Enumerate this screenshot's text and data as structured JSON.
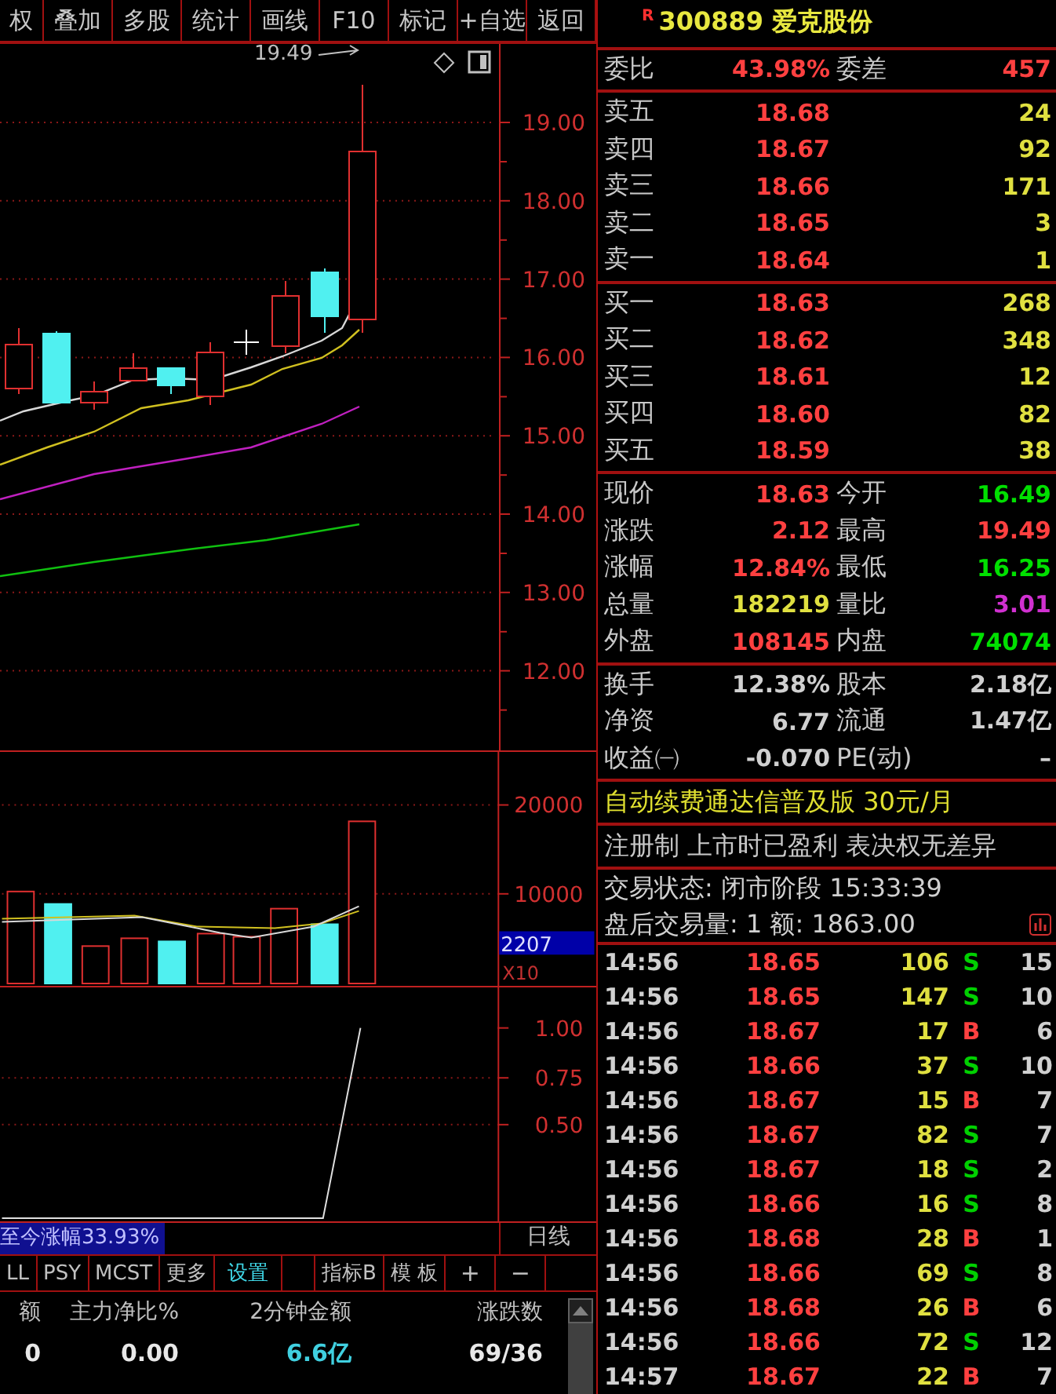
{
  "toolbar": [
    "权",
    "叠加",
    "多股",
    "统计",
    "画线",
    "F10",
    "标记",
    "+自选",
    "返回"
  ],
  "price_chart": {
    "high_label": "19.49",
    "axis_labels": [
      "19.00",
      "18.00",
      "17.00",
      "16.00",
      "15.00",
      "14.00",
      "13.00",
      "12.00"
    ]
  },
  "volume_chart": {
    "axis_labels": [
      "20000",
      "10000"
    ],
    "current_volume": "2207",
    "unit": "X10"
  },
  "indicator_chart": {
    "axis_labels": [
      "1.00",
      "0.75",
      "0.50"
    ]
  },
  "range_gain": "至今涨幅33.93%",
  "period": "日线",
  "indicator_tabs": [
    {
      "label": "LL",
      "selected": false
    },
    {
      "label": "PSY",
      "selected": false
    },
    {
      "label": "MCST",
      "selected": false
    },
    {
      "label": "更多",
      "selected": false
    },
    {
      "label": "设置",
      "selected": true
    },
    {
      "label": "指标B",
      "selected": false
    },
    {
      "label": "模 板",
      "selected": false
    }
  ],
  "zoom_buttons": [
    "+",
    "−"
  ],
  "sector_table": {
    "columns": [
      "额",
      "主力净比%",
      "2分钟金额",
      "涨跌数"
    ],
    "rows": [
      [
        "0",
        "0.00",
        "6.6亿",
        "69/36"
      ]
    ]
  },
  "stock": {
    "flag": "R",
    "title": "300889 爱克股份"
  },
  "order_ratio": [
    {
      "label": "委比",
      "value": "43.98%"
    },
    {
      "label": "委差",
      "value": "457"
    }
  ],
  "asks": [
    {
      "label": "卖五",
      "price": "18.68",
      "volume": "24"
    },
    {
      "label": "卖四",
      "price": "18.67",
      "volume": "92"
    },
    {
      "label": "卖三",
      "price": "18.66",
      "volume": "171"
    },
    {
      "label": "卖二",
      "price": "18.65",
      "volume": "3"
    },
    {
      "label": "卖一",
      "price": "18.64",
      "volume": "1"
    }
  ],
  "bids": [
    {
      "label": "买一",
      "price": "18.63",
      "volume": "268"
    },
    {
      "label": "买二",
      "price": "18.62",
      "volume": "348"
    },
    {
      "label": "买三",
      "price": "18.61",
      "volume": "12"
    },
    {
      "label": "买四",
      "price": "18.60",
      "volume": "82"
    },
    {
      "label": "买五",
      "price": "18.59",
      "volume": "38"
    }
  ],
  "quote": [
    {
      "label": "现价",
      "value": "18.63",
      "color": "#ff4040"
    },
    {
      "label": "今开",
      "value": "16.49",
      "color": "#00e000"
    },
    {
      "label": "涨跌",
      "value": "2.12",
      "color": "#ff4040"
    },
    {
      "label": "最高",
      "value": "19.49",
      "color": "#ff4040"
    },
    {
      "label": "涨幅",
      "value": "12.84%",
      "color": "#ff4040"
    },
    {
      "label": "最低",
      "value": "16.25",
      "color": "#00e000"
    },
    {
      "label": "总量",
      "value": "182219",
      "color": "#e0e040"
    },
    {
      "label": "量比",
      "value": "3.01",
      "color": "#d030d0"
    },
    {
      "label": "外盘",
      "value": "108145",
      "color": "#ff4040"
    },
    {
      "label": "内盘",
      "value": "74074",
      "color": "#00e000"
    }
  ],
  "fundamentals": [
    {
      "label": "换手",
      "value": "12.38%"
    },
    {
      "label": "股本",
      "value": "2.18亿"
    },
    {
      "label": "净资",
      "value": "6.77"
    },
    {
      "label": "流通",
      "value": "1.47亿"
    },
    {
      "label": "收益㈠",
      "value": "-0.070"
    },
    {
      "label": "PE(动)",
      "value": "–"
    }
  ],
  "promo": "自动续费通达信普及版  30元/月",
  "tags": "注册制 上市时已盈利 表决权无差异",
  "status": "交易状态: 闭市阶段 15:33:39",
  "after_hours": "盘后交易量: 1  额: 1863.00",
  "ticks": [
    {
      "time": "14:56",
      "price": "18.65",
      "volume": "106",
      "side": "S",
      "color": "#00d000",
      "count": "15"
    },
    {
      "time": "14:56",
      "price": "18.65",
      "volume": "147",
      "side": "S",
      "color": "#00d000",
      "count": "10"
    },
    {
      "time": "14:56",
      "price": "18.67",
      "volume": "17",
      "side": "B",
      "color": "#ff4040",
      "count": "6"
    },
    {
      "time": "14:56",
      "price": "18.66",
      "volume": "37",
      "side": "S",
      "color": "#00d000",
      "count": "10"
    },
    {
      "time": "14:56",
      "price": "18.67",
      "volume": "15",
      "side": "B",
      "color": "#ff4040",
      "count": "7"
    },
    {
      "time": "14:56",
      "price": "18.67",
      "volume": "82",
      "side": "S",
      "color": "#00d000",
      "count": "7"
    },
    {
      "time": "14:56",
      "price": "18.67",
      "volume": "18",
      "side": "S",
      "color": "#00d000",
      "count": "2"
    },
    {
      "time": "14:56",
      "price": "18.66",
      "volume": "16",
      "side": "S",
      "color": "#00d000",
      "count": "8"
    },
    {
      "time": "14:56",
      "price": "18.68",
      "volume": "28",
      "side": "B",
      "color": "#ff4040",
      "count": "1"
    },
    {
      "time": "14:56",
      "price": "18.66",
      "volume": "69",
      "side": "S",
      "color": "#00d000",
      "count": "8"
    },
    {
      "time": "14:56",
      "price": "18.68",
      "volume": "26",
      "side": "B",
      "color": "#ff4040",
      "count": "6"
    },
    {
      "time": "14:56",
      "price": "18.66",
      "volume": "72",
      "side": "S",
      "color": "#00d000",
      "count": "12"
    },
    {
      "time": "14:57",
      "price": "18.67",
      "volume": "22",
      "side": "B",
      "color": "#ff4040",
      "count": "7"
    }
  ]
}
